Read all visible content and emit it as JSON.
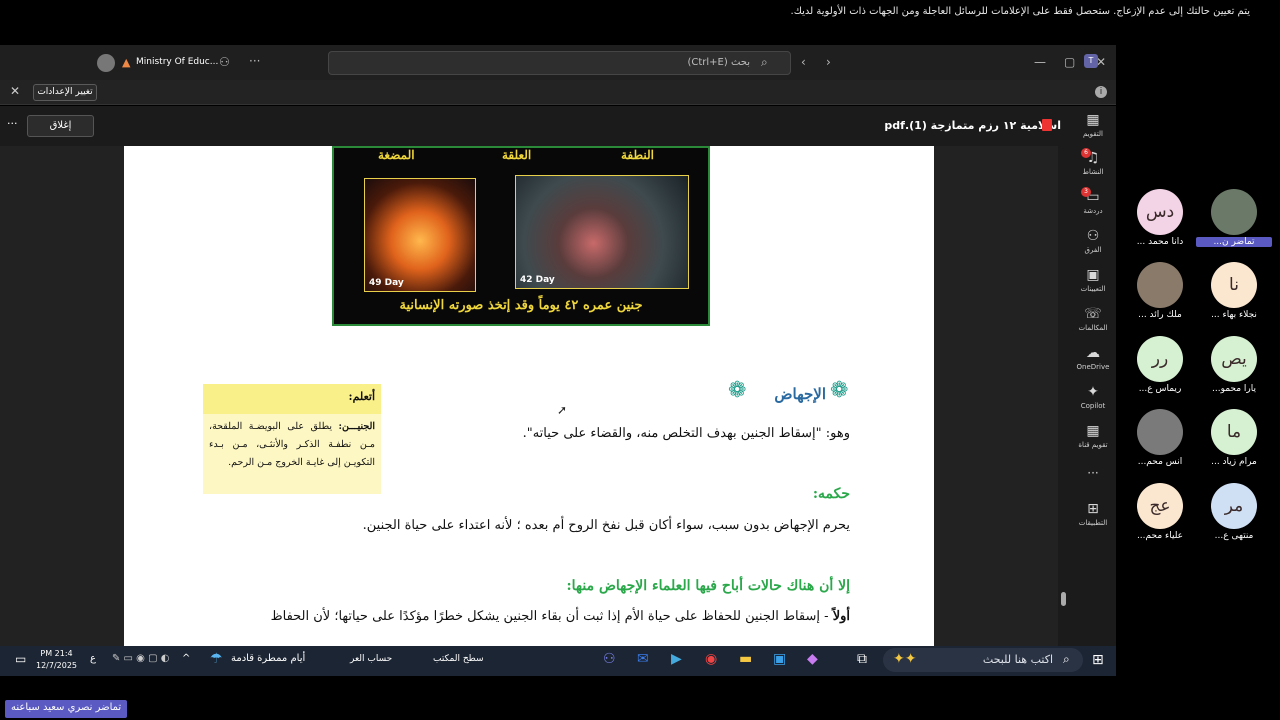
{
  "title_bar": {
    "org_name": "Ministry Of Educ...",
    "search_placeholder": "بحث (Ctrl+E)"
  },
  "banner": {
    "message": "يتم تعيين حالتك إلى عدم الإزعاج. ستحصل فقط على الإعلامات للرسائل العاجلة ومن الجهات ذات الأولوية لديك.",
    "settings_button": "تغيير الإعدادات"
  },
  "file_bar": {
    "file_name": "اسلامية ١٢ رزم متمازجة (1).pdf",
    "close_button": "إغلاق",
    "more": "···"
  },
  "document": {
    "stage_labels": [
      "النطفة",
      "العلقة",
      "المضغة"
    ],
    "day_labels": [
      "42 Day",
      "49 Day"
    ],
    "image_caption": "جنين عمره ٤٢ يوماً وقد إتخذ صورته الإنسانية",
    "section_title": "الإجهاض",
    "definition": "وهو: \"إسقاط الجنين بهدف التخلص منه، والقضاء على حياته\".",
    "learn_box": {
      "heading": "أتعلم:",
      "term": "الجنيـــن:",
      "body": "يطلق على البويضـة الملقحة، مـن نطفـة الذكـر والأنثـى، مـن بـدء التكويـن إلى غايـة الخروج مـن الرحم."
    },
    "ruling_title": "حكمه:",
    "ruling_text": "يحرم الإجهاض بدون سبب، سواء أكان قبل نفخ الروح أم بعده ؛ لأنه اعتداء على حياة الجنين.",
    "exceptions_title": "إلا أن هناك حالات أباح فيها العلماء الإجهاض منها:",
    "first_case_label": "أولاً",
    "first_case_text": " - إسقاط الجنين للحفاظ على حياة الأم إذا ثبت أن بقاء الجنين يشكل خطرًا مؤكدًا على حياتها؛ لأن الحفاظ"
  },
  "rail": [
    {
      "label": "التقويم",
      "icon": "calendar-icon"
    },
    {
      "label": "النشاط",
      "icon": "bell-icon",
      "badge": "6"
    },
    {
      "label": "دردشة",
      "icon": "chat-icon",
      "badge": "3"
    },
    {
      "label": "الفرق",
      "icon": "teams-icon"
    },
    {
      "label": "التعيينات",
      "icon": "backpack-icon"
    },
    {
      "label": "المكالمات",
      "icon": "phone-icon"
    },
    {
      "label": "OneDrive",
      "icon": "cloud-icon"
    },
    {
      "label": "Copilot",
      "icon": "copilot-icon"
    },
    {
      "label": "تقويم قناة",
      "icon": "calendar-grid-icon"
    },
    {
      "label": "التطبيقات",
      "icon": "add-apps-icon"
    }
  ],
  "participants": [
    {
      "initials": "",
      "name": "تماضر ن...",
      "color": "#6b7a68"
    },
    {
      "initials": "دس",
      "name": "دانا محمد ...",
      "color": "#f3d3e6"
    },
    {
      "initials": "نا",
      "name": "نجلاء بهاء ...",
      "color": "#fbe6cf"
    },
    {
      "initials": "",
      "name": "ملك رائد ...",
      "color": "#8a7a6a"
    },
    {
      "initials": "يص",
      "name": "يارا محمو...",
      "color": "#d6f0d2"
    },
    {
      "initials": "رر",
      "name": "ريماس ع...",
      "color": "#d6f0d2"
    },
    {
      "initials": "ما",
      "name": "مرام زياد ...",
      "color": "#d6f0d2"
    },
    {
      "initials": "",
      "name": "انس محم...",
      "color": "#7a7a7a"
    },
    {
      "initials": "مر",
      "name": "منتهى ع...",
      "color": "#cfe0f5"
    },
    {
      "initials": "عج",
      "name": "علياء محم...",
      "color": "#fbe6cf"
    }
  ],
  "taskbar": {
    "search_placeholder": "اكتب هنا للبحث",
    "weather": "أيام ممطرة قادمة",
    "desktop_label": "سطح المكتب",
    "account_label": "حساب العر",
    "time": "PM 21:4",
    "date": "12/7/2025",
    "lang": "ع"
  },
  "bottom_tag": "تماضر نصري سعيد سباعنه"
}
